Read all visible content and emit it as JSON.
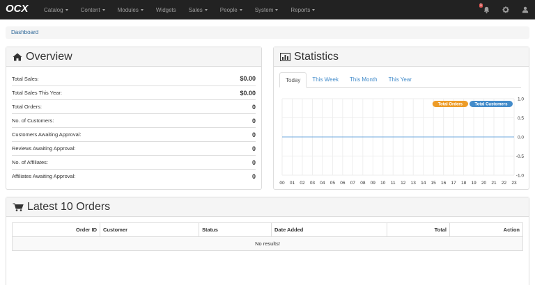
{
  "brand": {
    "logo_text": "OCX"
  },
  "nav": [
    {
      "label": "Catalog",
      "dropdown": true
    },
    {
      "label": "Content",
      "dropdown": true
    },
    {
      "label": "Modules",
      "dropdown": true
    },
    {
      "label": "Widgets",
      "dropdown": false
    },
    {
      "label": "Sales",
      "dropdown": true
    },
    {
      "label": "People",
      "dropdown": true
    },
    {
      "label": "System",
      "dropdown": true
    },
    {
      "label": "Reports",
      "dropdown": true
    }
  ],
  "top_icons": {
    "notifications_badge": "1"
  },
  "breadcrumb": {
    "label": "Dashboard"
  },
  "overview": {
    "title": "Overview",
    "rows": [
      {
        "label": "Total Sales:",
        "value": "$0.00"
      },
      {
        "label": "Total Sales This Year:",
        "value": "$0.00"
      },
      {
        "label": "Total Orders:",
        "value": "0"
      },
      {
        "label": "No. of Customers:",
        "value": "0"
      },
      {
        "label": "Customers Awaiting Approval:",
        "value": "0"
      },
      {
        "label": "Reviews Awaiting Approval:",
        "value": "0"
      },
      {
        "label": "No. of Affiliates:",
        "value": "0"
      },
      {
        "label": "Affiliates Awaiting Approval:",
        "value": "0"
      }
    ]
  },
  "statistics": {
    "title": "Statistics",
    "tabs": [
      "Today",
      "This Week",
      "This Month",
      "This Year"
    ],
    "active_tab": "Today",
    "legend": [
      {
        "label": "Total Orders",
        "color": "#ed9c28"
      },
      {
        "label": "Total Customers",
        "color": "#428bca"
      }
    ]
  },
  "chart_data": {
    "type": "line",
    "x": [
      "00",
      "01",
      "02",
      "03",
      "04",
      "05",
      "06",
      "07",
      "08",
      "09",
      "10",
      "11",
      "12",
      "13",
      "14",
      "15",
      "16",
      "17",
      "18",
      "19",
      "20",
      "21",
      "22",
      "23"
    ],
    "series": [
      {
        "name": "Total Orders",
        "values": [
          0,
          0,
          0,
          0,
          0,
          0,
          0,
          0,
          0,
          0,
          0,
          0,
          0,
          0,
          0,
          0,
          0,
          0,
          0,
          0,
          0,
          0,
          0,
          0
        ]
      },
      {
        "name": "Total Customers",
        "values": [
          0,
          0,
          0,
          0,
          0,
          0,
          0,
          0,
          0,
          0,
          0,
          0,
          0,
          0,
          0,
          0,
          0,
          0,
          0,
          0,
          0,
          0,
          0,
          0
        ]
      }
    ],
    "yticks": [
      "1.0",
      "0.5",
      "0.0",
      "-0.5",
      "-1.0"
    ],
    "ylim": [
      -1,
      1
    ],
    "grid": true,
    "legend_position": "top-right"
  },
  "orders": {
    "title": "Latest 10 Orders",
    "columns": [
      "Order ID",
      "Customer",
      "Status",
      "Date Added",
      "Total",
      "Action"
    ],
    "empty_text": "No results!"
  }
}
